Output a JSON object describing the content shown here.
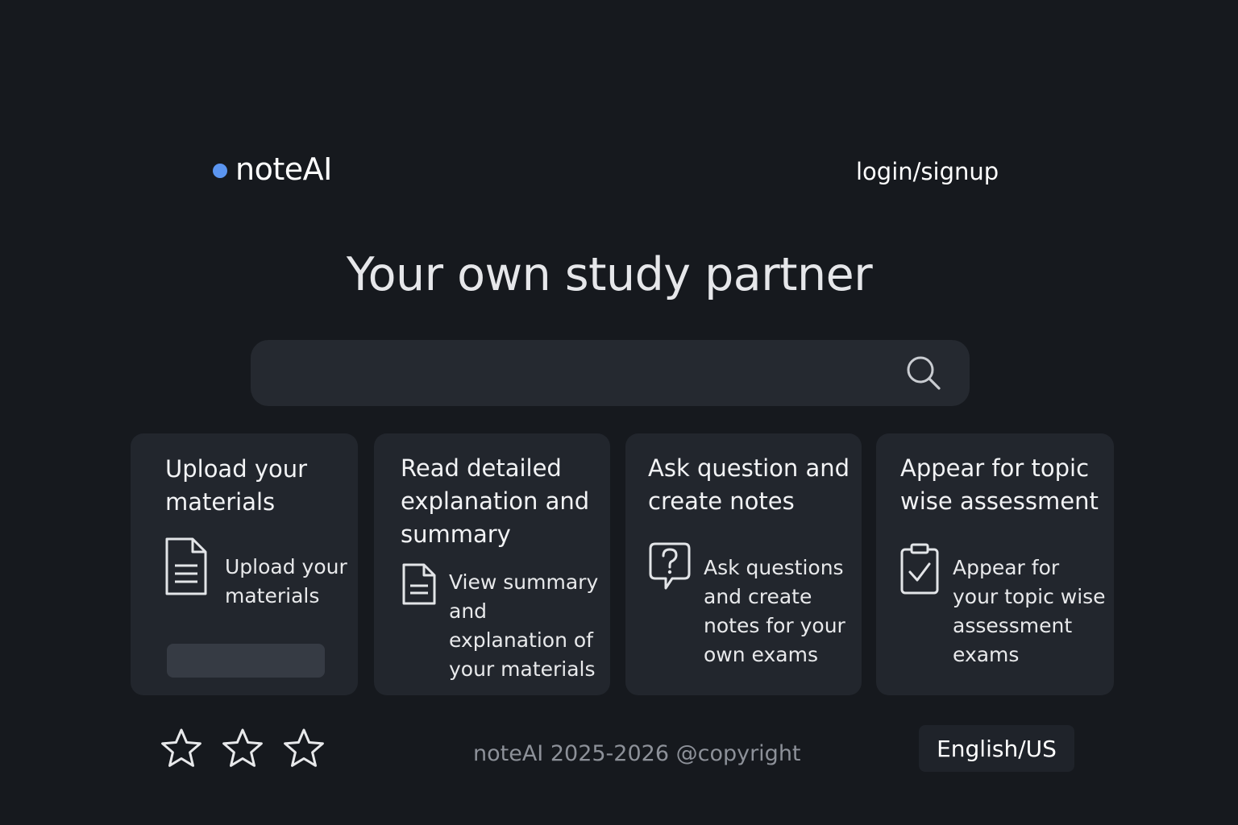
{
  "brand": {
    "name": "noteAI",
    "dot_color": "#5b95f0"
  },
  "header": {
    "login_label": "login/signup"
  },
  "hero": {
    "title": "Your own study partner"
  },
  "search": {
    "placeholder": "",
    "value": "",
    "icon": "search-icon"
  },
  "cards": [
    {
      "title": "Upload your materials",
      "icon": "document-icon",
      "description": "Upload your materials",
      "has_button": true
    },
    {
      "title": "Read detailed explanation and summary",
      "icon": "document-icon",
      "description": "View summary and explanation of your materials"
    },
    {
      "title": "Ask question and create notes",
      "icon": "question-bubble-icon",
      "description": "Ask questions and create notes for your own exams"
    },
    {
      "title": "Appear for topic wise assessment",
      "icon": "clipboard-check-icon",
      "description": "Appear for your topic wise assessment exams"
    }
  ],
  "footer": {
    "stars": [
      "star-icon",
      "star-icon",
      "star-icon"
    ],
    "copyright": "noteAI 2025-2026 @copyright",
    "language": "English/US"
  }
}
